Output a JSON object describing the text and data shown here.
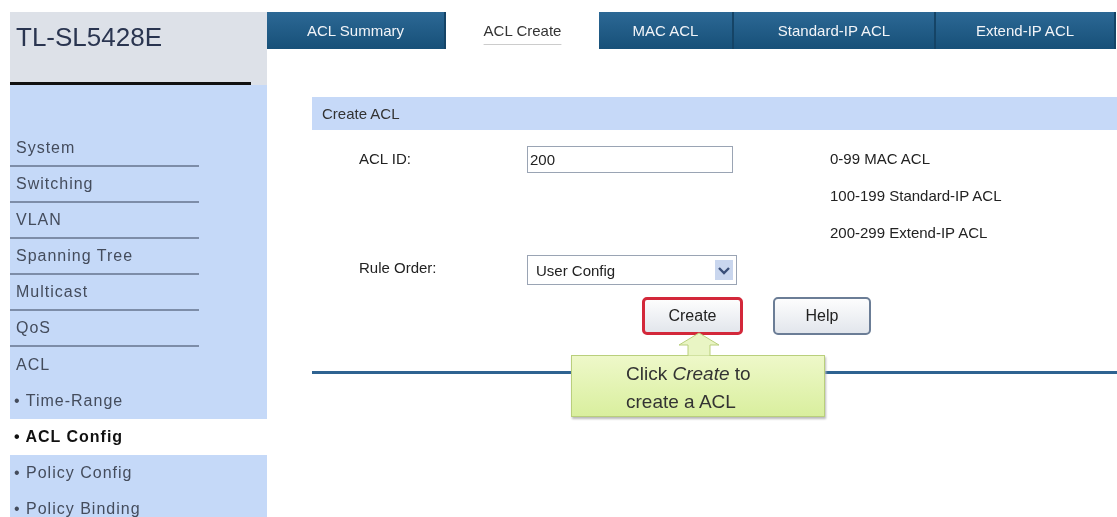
{
  "logo": "TL-SL5428E",
  "tabs": [
    {
      "label": "ACL Summary",
      "selected": false
    },
    {
      "label": "ACL Create",
      "selected": true
    },
    {
      "label": "MAC ACL",
      "selected": false
    },
    {
      "label": "Standard-IP ACL",
      "selected": false
    },
    {
      "label": "Extend-IP ACL",
      "selected": false
    }
  ],
  "sidebar": {
    "items": [
      {
        "label": "System",
        "kind": "section",
        "selected": false
      },
      {
        "label": "Switching",
        "kind": "section",
        "selected": false
      },
      {
        "label": "VLAN",
        "kind": "section",
        "selected": false
      },
      {
        "label": "Spanning Tree",
        "kind": "section",
        "selected": false
      },
      {
        "label": "Multicast",
        "kind": "section",
        "selected": false
      },
      {
        "label": "QoS",
        "kind": "section",
        "selected": false
      },
      {
        "label": "ACL",
        "kind": "group",
        "selected": false
      },
      {
        "label": "• Time-Range",
        "kind": "sub",
        "selected": false
      },
      {
        "label": "• ACL Config",
        "kind": "sub",
        "selected": true
      },
      {
        "label": "• Policy Config",
        "kind": "sub",
        "selected": false
      },
      {
        "label": "• Policy Binding",
        "kind": "sub",
        "selected": false
      }
    ]
  },
  "panel": {
    "title": "Create ACL",
    "acl_id": {
      "label": "ACL ID:",
      "value": "200"
    },
    "ranges": [
      "0-99 MAC ACL",
      "100-199 Standard-IP ACL",
      "200-299 Extend-IP ACL"
    ],
    "rule_order": {
      "label": "Rule Order:",
      "value": "User Config"
    },
    "buttons": [
      {
        "label": "Create",
        "highlighted": true
      },
      {
        "label": "Help",
        "highlighted": false
      }
    ]
  },
  "callout": {
    "lines": [
      "Click *Create* to",
      "create a ACL"
    ]
  }
}
